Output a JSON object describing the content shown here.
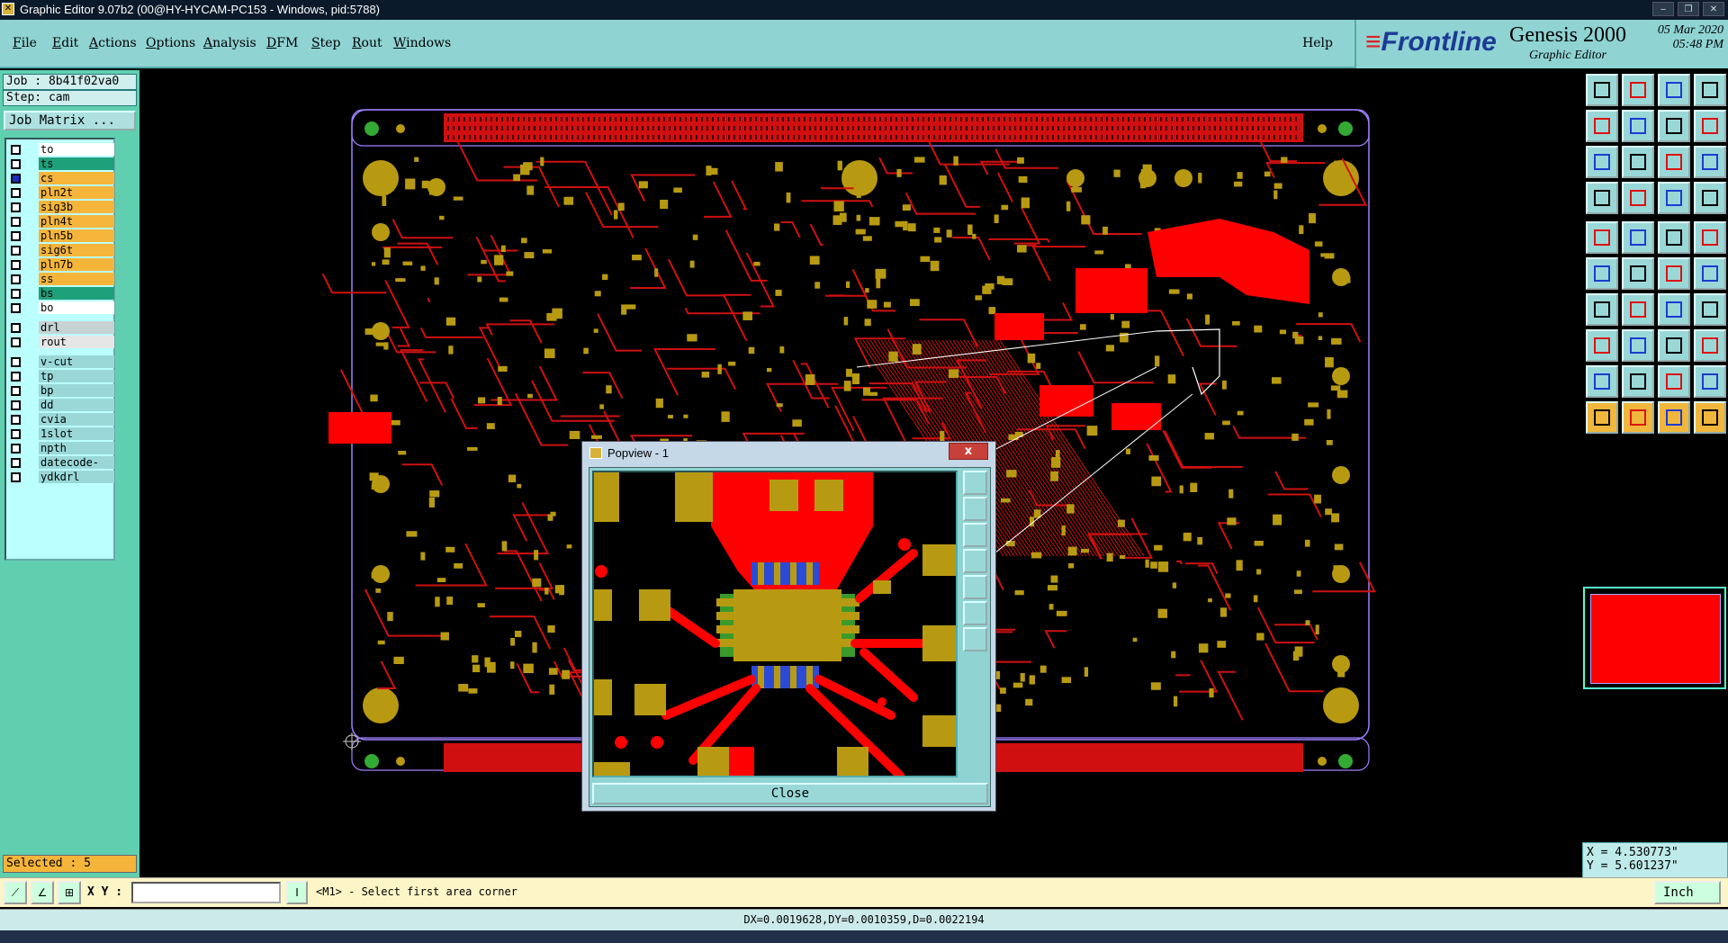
{
  "window": {
    "title": "Graphic Editor 9.07b2 (00@HY-HYCAM-PC153 - Windows, pid:5788)",
    "controls": [
      "–",
      "❐",
      "✕"
    ]
  },
  "menu": {
    "items": [
      "File",
      "Edit",
      "Actions",
      "Options",
      "Analysis",
      "DFM",
      "Step",
      "Rout",
      "Windows"
    ],
    "help": "Help"
  },
  "brand": {
    "logo": "Frontline",
    "product": "Genesis 2000",
    "subtitle": "Graphic Editor",
    "date": "05 Mar 2020",
    "time": "05:48 PM"
  },
  "job": {
    "job_label": "Job : 8b41f02va0",
    "step_label": "Step: cam",
    "matrix_button": "Job Matrix ..."
  },
  "layers": [
    {
      "name": "to",
      "color": "#ffffff",
      "checked": false
    },
    {
      "name": "ts",
      "color": "#1ea07a",
      "checked": false
    },
    {
      "name": "cs",
      "color": "#f5b53b",
      "checked": true
    },
    {
      "name": "pln2t",
      "color": "#f5b53b",
      "checked": false
    },
    {
      "name": "sig3b",
      "color": "#f5b53b",
      "checked": false
    },
    {
      "name": "pln4t",
      "color": "#f5b53b",
      "checked": false
    },
    {
      "name": "pln5b",
      "color": "#f5b53b",
      "checked": false
    },
    {
      "name": "sig6t",
      "color": "#f5b53b",
      "checked": false
    },
    {
      "name": "pln7b",
      "color": "#f5b53b",
      "checked": false
    },
    {
      "name": "ss",
      "color": "#f5b53b",
      "checked": false
    },
    {
      "name": "bs",
      "color": "#1ea07a",
      "checked": false
    },
    {
      "name": "bo",
      "color": "#ffffff",
      "checked": false
    },
    {
      "name": "drl",
      "color": "#c7d3d3",
      "checked": false
    },
    {
      "name": "rout",
      "color": "#e6e6e6",
      "checked": false
    },
    {
      "name": "v-cut",
      "color": "#9ad8d8",
      "checked": false
    },
    {
      "name": "tp",
      "color": "#9ad8d8",
      "checked": false
    },
    {
      "name": "bp",
      "color": "#9ad8d8",
      "checked": false
    },
    {
      "name": "dd",
      "color": "#9ad8d8",
      "checked": false
    },
    {
      "name": "cvia",
      "color": "#9ad8d8",
      "checked": false
    },
    {
      "name": "1slot",
      "color": "#9ad8d8",
      "checked": false
    },
    {
      "name": "npth",
      "color": "#9ad8d8",
      "checked": false
    },
    {
      "name": "datecode-pte",
      "color": "#9ad8d8",
      "checked": false
    },
    {
      "name": "ydkdrl",
      "color": "#9ad8d8",
      "checked": false
    }
  ],
  "selected": "Selected : 5",
  "popview": {
    "title": "Popview - 1",
    "close_label": "Close",
    "close_x": "x"
  },
  "toolbar_icons": [
    "snap-icon",
    "step-out-icon",
    "home-icon",
    "layout-icon",
    "prev-icon",
    "next-icon",
    "split-icon",
    "route-icon",
    "zoom-fit-icon",
    "zoom-center-icon",
    "scale-icon",
    "help-icon",
    "layers-icon",
    "grid-icon",
    "select-panel-icon",
    "highlight-panel-icon",
    "pad-icon",
    "measure-icon",
    "ruler-icon",
    "dot-icon",
    "connect-icon",
    "delete-node-icon",
    "add-node-icon",
    "move-node-icon",
    "line-icon",
    "slash-line-icon",
    "arc-icon",
    "bend-icon",
    "pad-move-icon",
    "dash-icon",
    "copy-icon",
    "array-icon",
    "text-icon",
    "text-a-icon",
    "text-b-icon",
    "text-c-icon",
    "pointer-icon",
    "pointer-a-icon",
    "pointer-b-icon",
    "pointer-route-icon"
  ],
  "coords": {
    "x": "X = 4.530773\"",
    "y": "Y = 5.601237\""
  },
  "command": {
    "xy_label": "X Y :",
    "xy_value": "",
    "prompt": "<M1> - Select first area corner",
    "units": "Inch"
  },
  "status": "DX=0.0019628,DY=0.0010359,D=0.0022194",
  "colors": {
    "copper": "#ff0000",
    "pad": "#b89a12",
    "panel": "#8fd3d3"
  }
}
